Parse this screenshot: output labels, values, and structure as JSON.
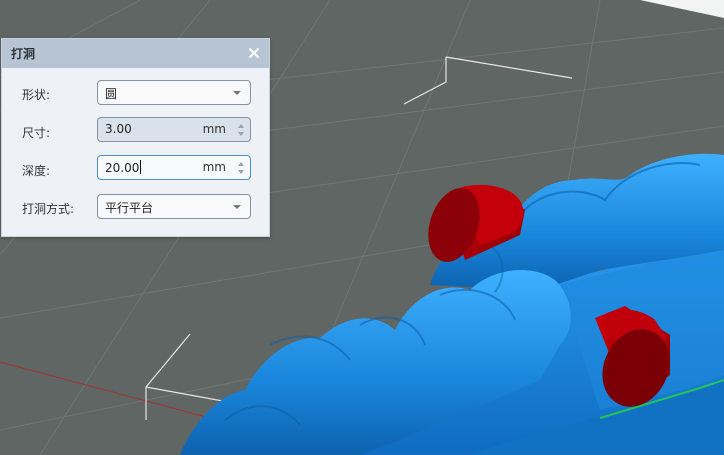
{
  "dialog": {
    "title": "打洞",
    "close_icon": "close-icon",
    "fields": {
      "shape": {
        "label": "形状:",
        "value": "圆"
      },
      "size": {
        "label": "尺寸:",
        "value": "3.00",
        "unit": "mm"
      },
      "depth": {
        "label": "深度:",
        "value": "20.00",
        "unit": "mm"
      },
      "method": {
        "label": "打洞方式:",
        "value": "平行平台"
      }
    }
  },
  "colors": {
    "background": "#5f6663",
    "grid": "#6f7673",
    "model": "#1e8fe0",
    "drill_cylinder": "#b00008",
    "dialog_header": "#b7c4d3",
    "focus_border": "#4a8fe0"
  }
}
